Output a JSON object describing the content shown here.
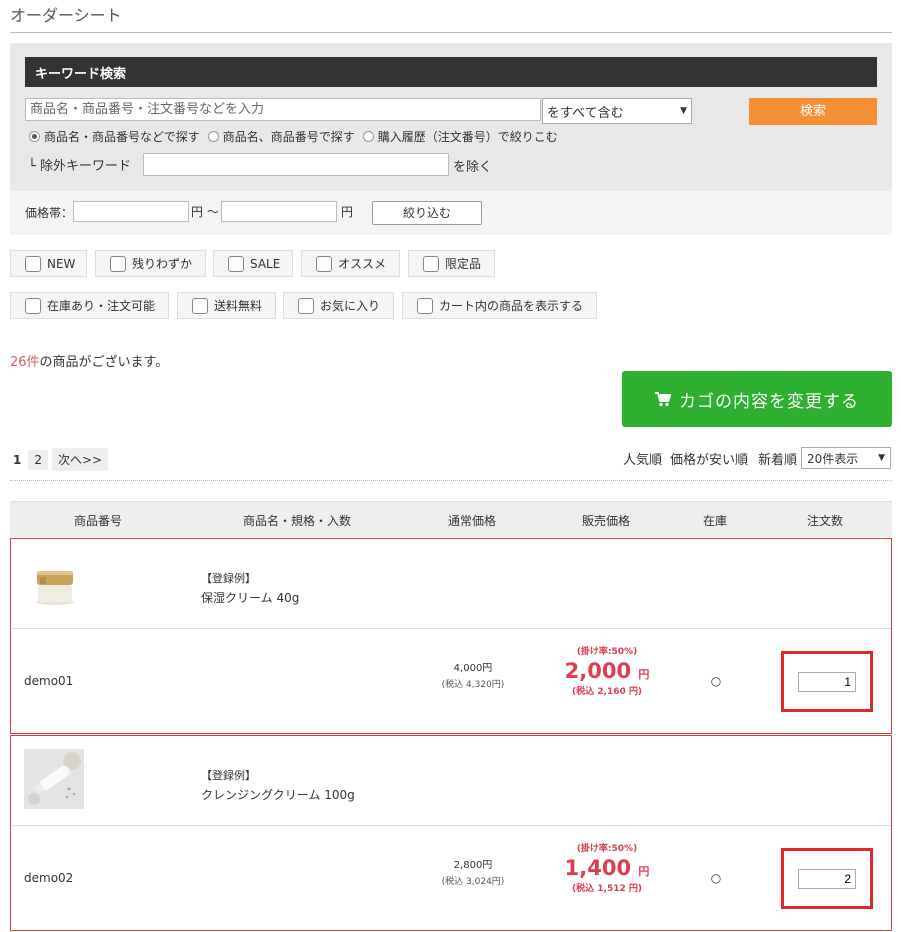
{
  "page": {
    "title": "オーダーシート"
  },
  "search": {
    "header": "キーワード検索",
    "keyword_placeholder": "商品名・商品番号・注文番号などを入力",
    "mode_selected": "をすべて含む",
    "button_label": "検索",
    "radios": [
      {
        "label": "商品名・商品番号などで探す",
        "checked": true
      },
      {
        "label": "商品名、商品番号で探す",
        "checked": false
      },
      {
        "label": "購入履歴（注文番号）で絞りこむ",
        "checked": false
      }
    ],
    "exclude_label": "└ 除外キーワード",
    "exclude_suffix": "を除く"
  },
  "price_filter": {
    "label": "価格帯：",
    "yen_min": "円 〜",
    "yen_max": "円",
    "button_label": "絞り込む"
  },
  "filters": {
    "row1": [
      "NEW",
      "残りわずか",
      "SALE",
      "オススメ",
      "限定品"
    ],
    "row2": [
      "在庫あり・注文可能",
      "送料無料",
      "お気に入り",
      "カート内の商品を表示する"
    ]
  },
  "results": {
    "count": "26件",
    "count_suffix": "の商品がございます。"
  },
  "cart_button": "カゴの内容を変更する",
  "pager": {
    "current": "1",
    "page2": "2",
    "next": "次へ>>"
  },
  "sort": {
    "popular": "人気順",
    "cheap": "価格が安い順",
    "newest": "新着順",
    "per_page": "20件表示"
  },
  "table": {
    "headers": [
      "商品番号",
      "商品名・規格・入数",
      "通常価格",
      "販売価格",
      "在庫",
      "注文数"
    ]
  },
  "products": [
    {
      "tag": "【登録例】",
      "name": "保湿クリーム 40g",
      "code": "demo01",
      "list_price": "4,000円",
      "list_price_tax": "(税込 4,320円)",
      "rate": "(掛け率:50%)",
      "sale_price": "2,000",
      "sale_unit": "円",
      "sale_tax": "(税込 2,160 円)",
      "stock": "○",
      "qty": "1"
    },
    {
      "tag": "【登録例】",
      "name": "クレンジングクリーム 100g",
      "code": "demo02",
      "list_price": "2,800円",
      "list_price_tax": "(税込 3,024円)",
      "rate": "(掛け率:50%)",
      "sale_price": "1,400",
      "sale_unit": "円",
      "sale_tax": "(税込 1,512 円)",
      "stock": "○",
      "qty": "2"
    }
  ]
}
